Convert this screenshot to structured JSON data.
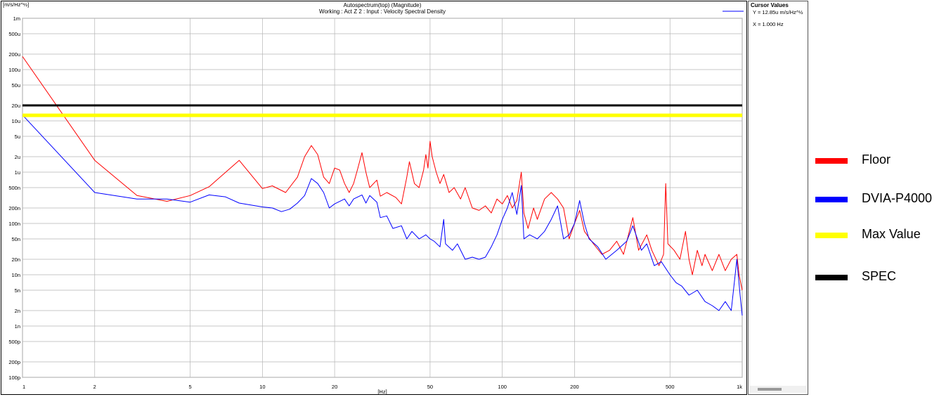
{
  "chart_data": {
    "type": "line",
    "title": "Autospectrum(top) (Magnitude)",
    "subtitle": "Working : Act Z 2 : Input : Velocity Spectral Density",
    "ylabel": "[m/s/Hz^½]",
    "xlabel": "[Hz]",
    "xscale": "log",
    "yscale": "log",
    "xlim": [
      1,
      1000
    ],
    "ylim": [
      1e-10,
      0.001
    ],
    "grid": true,
    "legend_position": "right, outside plot",
    "x_ticks": [
      {
        "value": 1,
        "label": "1"
      },
      {
        "value": 2,
        "label": "2"
      },
      {
        "value": 5,
        "label": "5"
      },
      {
        "value": 10,
        "label": "10"
      },
      {
        "value": 20,
        "label": "20"
      },
      {
        "value": 50,
        "label": "50"
      },
      {
        "value": 100,
        "label": "100"
      },
      {
        "value": 200,
        "label": "200"
      },
      {
        "value": 500,
        "label": "500"
      },
      {
        "value": 1000,
        "label": "1k"
      }
    ],
    "y_ticks": [
      {
        "value": 0.001,
        "label": "1m"
      },
      {
        "value": 0.0005,
        "label": "500u"
      },
      {
        "value": 0.0002,
        "label": "200u"
      },
      {
        "value": 0.0001,
        "label": "100u"
      },
      {
        "value": 5e-05,
        "label": "50u"
      },
      {
        "value": 2e-05,
        "label": "20u"
      },
      {
        "value": 1e-05,
        "label": "10u"
      },
      {
        "value": 5e-06,
        "label": "5u"
      },
      {
        "value": 2e-06,
        "label": "2u"
      },
      {
        "value": 1e-06,
        "label": "1u"
      },
      {
        "value": 5e-07,
        "label": "500n"
      },
      {
        "value": 2e-07,
        "label": "200n"
      },
      {
        "value": 1e-07,
        "label": "100n"
      },
      {
        "value": 5e-08,
        "label": "50n"
      },
      {
        "value": 2e-08,
        "label": "20n"
      },
      {
        "value": 1e-08,
        "label": "10n"
      },
      {
        "value": 5e-09,
        "label": "5n"
      },
      {
        "value": 2e-09,
        "label": "2n"
      },
      {
        "value": 1e-09,
        "label": "1n"
      },
      {
        "value": 5e-10,
        "label": "500p"
      },
      {
        "value": 2e-10,
        "label": "200p"
      },
      {
        "value": 1e-10,
        "label": "100p"
      }
    ],
    "series": [
      {
        "name": "Floor",
        "color": "#ff0000",
        "stroke": 1,
        "points": [
          [
            1,
            0.00018
          ],
          [
            2,
            1.7e-06
          ],
          [
            3,
            3.5e-07
          ],
          [
            4,
            2.7e-07
          ],
          [
            5,
            3.5e-07
          ],
          [
            6,
            5.2e-07
          ],
          [
            8,
            1.7e-06
          ],
          [
            10,
            4.8e-07
          ],
          [
            11,
            5.4e-07
          ],
          [
            12.5,
            4e-07
          ],
          [
            14,
            8e-07
          ],
          [
            15,
            2e-06
          ],
          [
            16,
            3.3e-06
          ],
          [
            17,
            2.2e-06
          ],
          [
            18,
            8e-07
          ],
          [
            19,
            6e-07
          ],
          [
            20,
            1.2e-06
          ],
          [
            21,
            1.1e-06
          ],
          [
            22,
            6e-07
          ],
          [
            23,
            4e-07
          ],
          [
            24,
            6e-07
          ],
          [
            25,
            1.2e-06
          ],
          [
            26,
            2.4e-06
          ],
          [
            27,
            1e-06
          ],
          [
            28,
            5e-07
          ],
          [
            30,
            7e-07
          ],
          [
            31,
            3.4e-07
          ],
          [
            33,
            4e-07
          ],
          [
            36,
            3.2e-07
          ],
          [
            38,
            2.4e-07
          ],
          [
            40,
            8e-07
          ],
          [
            41,
            1.6e-06
          ],
          [
            43,
            6e-07
          ],
          [
            45,
            5e-07
          ],
          [
            47,
            1.1e-06
          ],
          [
            48,
            2.2e-06
          ],
          [
            49,
            1.2e-06
          ],
          [
            50,
            4e-06
          ],
          [
            51,
            2e-06
          ],
          [
            53,
            1e-06
          ],
          [
            55,
            6e-07
          ],
          [
            57,
            9e-07
          ],
          [
            60,
            4e-07
          ],
          [
            63,
            5e-07
          ],
          [
            67,
            3e-07
          ],
          [
            70,
            5e-07
          ],
          [
            75,
            2e-07
          ],
          [
            80,
            1.8e-07
          ],
          [
            85,
            2.2e-07
          ],
          [
            90,
            1.6e-07
          ],
          [
            95,
            3e-07
          ],
          [
            100,
            2.4e-07
          ],
          [
            105,
            3.5e-07
          ],
          [
            110,
            2e-07
          ],
          [
            115,
            2.8e-07
          ],
          [
            120,
            1e-06
          ],
          [
            123,
            1.6e-07
          ],
          [
            128,
            8e-08
          ],
          [
            135,
            2e-07
          ],
          [
            140,
            1.2e-07
          ],
          [
            150,
            3e-07
          ],
          [
            160,
            4e-07
          ],
          [
            170,
            3e-07
          ],
          [
            180,
            2e-07
          ],
          [
            190,
            5e-08
          ],
          [
            200,
            1e-07
          ],
          [
            210,
            1.8e-07
          ],
          [
            220,
            7e-08
          ],
          [
            240,
            4e-08
          ],
          [
            260,
            2.5e-08
          ],
          [
            280,
            3e-08
          ],
          [
            300,
            4.5e-08
          ],
          [
            320,
            2.5e-08
          ],
          [
            350,
            1.3e-07
          ],
          [
            370,
            3e-08
          ],
          [
            400,
            6e-08
          ],
          [
            420,
            3e-08
          ],
          [
            450,
            1.5e-08
          ],
          [
            470,
            2.5e-08
          ],
          [
            480,
            6e-07
          ],
          [
            490,
            4e-08
          ],
          [
            520,
            3e-08
          ],
          [
            550,
            2e-08
          ],
          [
            580,
            7e-08
          ],
          [
            600,
            2e-08
          ],
          [
            620,
            1e-08
          ],
          [
            650,
            3e-08
          ],
          [
            680,
            1.5e-08
          ],
          [
            700,
            2.5e-08
          ],
          [
            750,
            1.2e-08
          ],
          [
            800,
            2.5e-08
          ],
          [
            850,
            1.2e-08
          ],
          [
            900,
            2e-08
          ],
          [
            950,
            2.5e-08
          ],
          [
            970,
            1e-08
          ],
          [
            1000,
            5e-09
          ]
        ]
      },
      {
        "name": "DVIA-P4000",
        "color": "#0000ff",
        "stroke": 1,
        "points": [
          [
            1,
            1.3e-05
          ],
          [
            2,
            4e-07
          ],
          [
            3,
            3e-07
          ],
          [
            4,
            3e-07
          ],
          [
            5,
            2.6e-07
          ],
          [
            6,
            3.6e-07
          ],
          [
            7,
            3.3e-07
          ],
          [
            8,
            2.5e-07
          ],
          [
            10,
            2.1e-07
          ],
          [
            11,
            2e-07
          ],
          [
            12,
            1.7e-07
          ],
          [
            13,
            1.9e-07
          ],
          [
            14,
            2.5e-07
          ],
          [
            15,
            3.5e-07
          ],
          [
            16,
            7.5e-07
          ],
          [
            17,
            6e-07
          ],
          [
            18,
            4e-07
          ],
          [
            19,
            2e-07
          ],
          [
            20,
            2.4e-07
          ],
          [
            22,
            3e-07
          ],
          [
            23,
            2.2e-07
          ],
          [
            24,
            3e-07
          ],
          [
            26,
            3.6e-07
          ],
          [
            27,
            2.5e-07
          ],
          [
            28,
            3.5e-07
          ],
          [
            30,
            2.6e-07
          ],
          [
            31,
            1.3e-07
          ],
          [
            33,
            1.4e-07
          ],
          [
            35,
            8e-08
          ],
          [
            38,
            9e-08
          ],
          [
            40,
            5e-08
          ],
          [
            42,
            7e-08
          ],
          [
            45,
            5e-08
          ],
          [
            48,
            6e-08
          ],
          [
            50,
            5e-08
          ],
          [
            52,
            4.5e-08
          ],
          [
            55,
            3.5e-08
          ],
          [
            57,
            1.2e-07
          ],
          [
            58,
            4e-08
          ],
          [
            62,
            3e-08
          ],
          [
            65,
            4e-08
          ],
          [
            70,
            2e-08
          ],
          [
            75,
            2.2e-08
          ],
          [
            80,
            2e-08
          ],
          [
            85,
            2.2e-08
          ],
          [
            90,
            3.5e-08
          ],
          [
            95,
            6e-08
          ],
          [
            100,
            1.2e-07
          ],
          [
            105,
            2e-07
          ],
          [
            110,
            4e-07
          ],
          [
            115,
            1.5e-07
          ],
          [
            120,
            5.5e-07
          ],
          [
            123,
            5e-08
          ],
          [
            130,
            6e-08
          ],
          [
            140,
            5e-08
          ],
          [
            150,
            7e-08
          ],
          [
            160,
            1.2e-07
          ],
          [
            170,
            2.2e-07
          ],
          [
            180,
            5e-08
          ],
          [
            190,
            6e-08
          ],
          [
            200,
            1e-07
          ],
          [
            210,
            2.8e-07
          ],
          [
            220,
            1e-07
          ],
          [
            230,
            5e-08
          ],
          [
            250,
            3.5e-08
          ],
          [
            270,
            2e-08
          ],
          [
            300,
            3e-08
          ],
          [
            330,
            4.5e-08
          ],
          [
            350,
            9e-08
          ],
          [
            380,
            3e-08
          ],
          [
            400,
            4e-08
          ],
          [
            430,
            1.5e-08
          ],
          [
            460,
            1.8e-08
          ],
          [
            500,
            1e-08
          ],
          [
            530,
            7e-09
          ],
          [
            560,
            6e-09
          ],
          [
            600,
            4e-09
          ],
          [
            650,
            5e-09
          ],
          [
            700,
            3e-09
          ],
          [
            750,
            2.5e-09
          ],
          [
            800,
            2e-09
          ],
          [
            850,
            3e-09
          ],
          [
            900,
            2e-09
          ],
          [
            950,
            2e-08
          ],
          [
            980,
            4e-09
          ],
          [
            1000,
            1.6e-09
          ]
        ]
      },
      {
        "name": "Max Value",
        "color": "#ffff00",
        "stroke": 5,
        "points": [
          [
            1,
            1.285e-05
          ],
          [
            1000,
            1.285e-05
          ]
        ]
      },
      {
        "name": "SPEC",
        "color": "#000000",
        "stroke": 3,
        "points": [
          [
            1,
            2e-05
          ],
          [
            1000,
            2e-05
          ]
        ]
      }
    ]
  },
  "cursor_values": {
    "title": "Cursor Values",
    "y_text": "Y = 12.85u m/s/Hz^½",
    "x_text": "X = 1.000 Hz"
  },
  "inline_legend": {
    "color": "#0000ff"
  },
  "legend": [
    {
      "label": "Floor",
      "color": "#ff0000"
    },
    {
      "label": "DVIA-P4000",
      "color": "#0000ff"
    },
    {
      "label": "Max Value",
      "color": "#ffff00"
    },
    {
      "label": "SPEC",
      "color": "#000000"
    }
  ]
}
